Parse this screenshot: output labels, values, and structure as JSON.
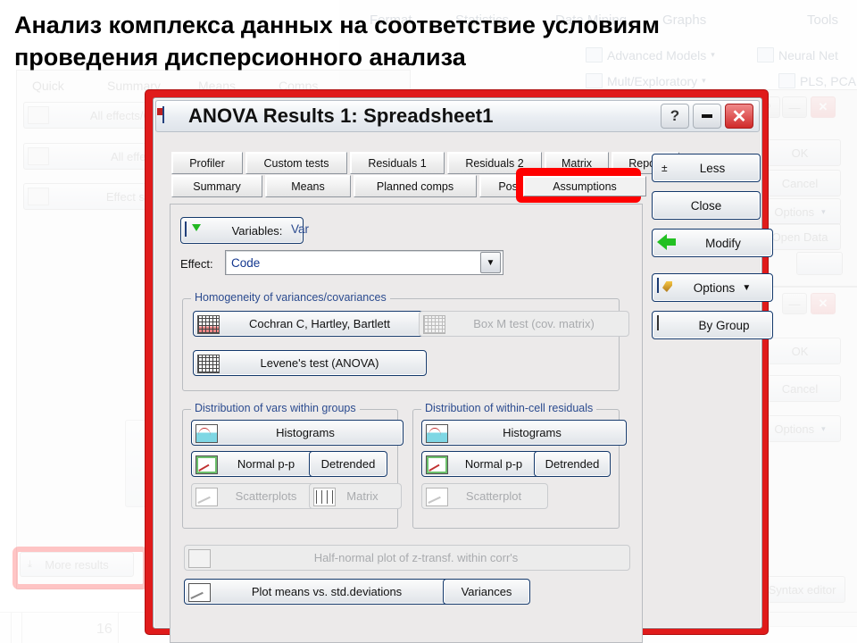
{
  "slide": {
    "heading_line1": "Анализ комплекса данных на соответствие условиям",
    "heading_line2": "проведения дисперсионного анализа",
    "cell_number": "16"
  },
  "background": {
    "menu_items": [
      "Format",
      "Statistics",
      "Data Mining",
      "Graphs",
      "Tools"
    ],
    "ribbon_buttons": [
      "Advanced Models",
      "Neural Net",
      "Mult/Exploratory",
      "PLS, PCA"
    ],
    "tabs": [
      "Quick",
      "Summary",
      "Means",
      "Comps"
    ],
    "left_buttons": [
      "All effects/Graphs",
      "All effects",
      "Effect sizes"
    ],
    "more_results_label": "More results",
    "dialog1_buttons": [
      "OK",
      "Cancel",
      "Options",
      "Open Data"
    ],
    "dialog2_buttons": [
      "OK",
      "Cancel",
      "Options",
      "Syntax editor"
    ]
  },
  "dialog": {
    "title": "ANOVA Results 1: Spreadsheet1",
    "title_icon": "spreadsheet-icon",
    "titlebar_buttons": {
      "help": "?",
      "minimize": "–",
      "close": "✕"
    },
    "tabs_row1": [
      "Profiler",
      "Custom tests",
      "Residuals 1",
      "Residuals 2",
      "Matrix",
      "Report"
    ],
    "tabs_row2": [
      "Summary",
      "Means",
      "Planned comps",
      "Post-hoc",
      "Assumptions"
    ],
    "active_tab": "Assumptions",
    "highlight_color": "#ff0000",
    "border_color": "#e01b1b",
    "command_buttons": [
      {
        "label": "Less",
        "symbol": "±",
        "icon": ""
      },
      {
        "label": "Close",
        "symbol": "",
        "icon": ""
      },
      {
        "label": "Modify",
        "symbol": "",
        "icon": "green-left-arrow-icon"
      },
      {
        "label": "Options",
        "symbol": "",
        "icon": "options-icon",
        "caret": "▼"
      },
      {
        "label": "By Group",
        "symbol": "",
        "icon": "by-group-icon"
      }
    ],
    "variables": {
      "button_label": "Variables:",
      "value": "Var"
    },
    "effect": {
      "label": "Effect:",
      "value": "Code",
      "arrow": "▼"
    },
    "homogeneity": {
      "group_label": "Homogeneity of variances/covariances",
      "buttons": [
        {
          "label": "Cochran C, Hartley, Bartlett",
          "enabled": true,
          "icon": "grid-red-icon"
        },
        {
          "label": "Levene's test (ANOVA)",
          "enabled": true,
          "icon": "grid-icon"
        },
        {
          "label": "Box M test (cov. matrix)",
          "enabled": false,
          "icon": "grid-icon"
        }
      ]
    },
    "dist_vars": {
      "group_label": "Distribution of vars within groups",
      "buttons": [
        {
          "label": "Histograms",
          "enabled": true,
          "icon": "histogram-icon"
        },
        {
          "label": "Normal p-p",
          "enabled": true,
          "icon": "normal-pp-icon"
        },
        {
          "label": "Detrended",
          "enabled": true,
          "icon": ""
        },
        {
          "label": "Scatterplots",
          "enabled": false,
          "icon": "scatterplot-icon"
        },
        {
          "label": "Matrix",
          "enabled": false,
          "icon": "matrix-icon"
        }
      ]
    },
    "dist_resid": {
      "group_label": "Distribution of within-cell residuals",
      "buttons": [
        {
          "label": "Histograms",
          "enabled": true,
          "icon": "histogram-icon"
        },
        {
          "label": "Normal p-p",
          "enabled": true,
          "icon": "normal-pp-icon"
        },
        {
          "label": "Detrended",
          "enabled": true,
          "icon": ""
        },
        {
          "label": "Scatterplot",
          "enabled": false,
          "icon": "scatterplot-icon"
        }
      ]
    },
    "bottom_buttons": [
      {
        "label": "Half-normal plot of z-transf. within corr's",
        "enabled": false,
        "icon": "plot-icon"
      },
      {
        "label": "Plot means vs. std.deviations",
        "enabled": true,
        "icon": "scatter-line-icon"
      },
      {
        "label": "Variances",
        "enabled": true,
        "icon": ""
      }
    ]
  }
}
